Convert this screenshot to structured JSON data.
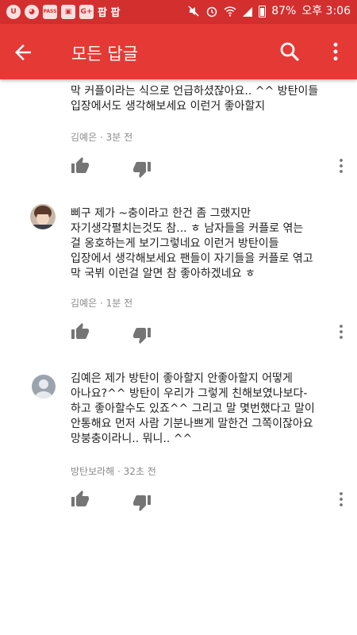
{
  "status_bar": {
    "notif_icons": [
      "U",
      "◕",
      "PASS",
      "▣",
      "G+"
    ],
    "app_label": "팝 팝",
    "battery_percent": "87%",
    "time": "오후 3:06"
  },
  "app_bar": {
    "title": "모든 답글"
  },
  "comments": [
    {
      "text_partial": "막 커플이라는 식으로 언급하셨잖아요.. ^^ 방탄이들\n입장에서도 생각해보세요 이런거 좋아할지",
      "author": "김예은",
      "time": "3분 전"
    },
    {
      "text": "삐구 제가 ~충이라고 한건 좀 그랬지만\n자기생각펼치는것도 참... ㅎ 남자들을 커플로 엮는\n걸 옹호하는게 보기그렇네요 이런거 방탄이들\n입장에서 생각해보세요 팬들이 자기들을 커플로 엮고\n막 국뷔 이런걸 알면 참 좋아하겠네요 ㅎ",
      "author": "김예은",
      "time": "1분 전"
    },
    {
      "text": "김예은 제가 방탄이 좋아할지 안좋아할지 어떻게\n아나요?^^ 방탄이 우리가 그렇게 친해보였나보다-\n하고 좋아할수도 있죠^^ 그리고 말 몇번했다고 말이\n안통해요 먼저 사람 기분나쁘게 말한건 그쪽이잖아요\n망붕충이라니.. 뭐니.. ^^",
      "author": "방탄보라해",
      "time": "32초 전"
    }
  ],
  "colors": {
    "status_bar": "#d32f2f",
    "app_bar": "#e53935",
    "action_icon": "#757575",
    "meta_text": "#8a8a8a"
  }
}
